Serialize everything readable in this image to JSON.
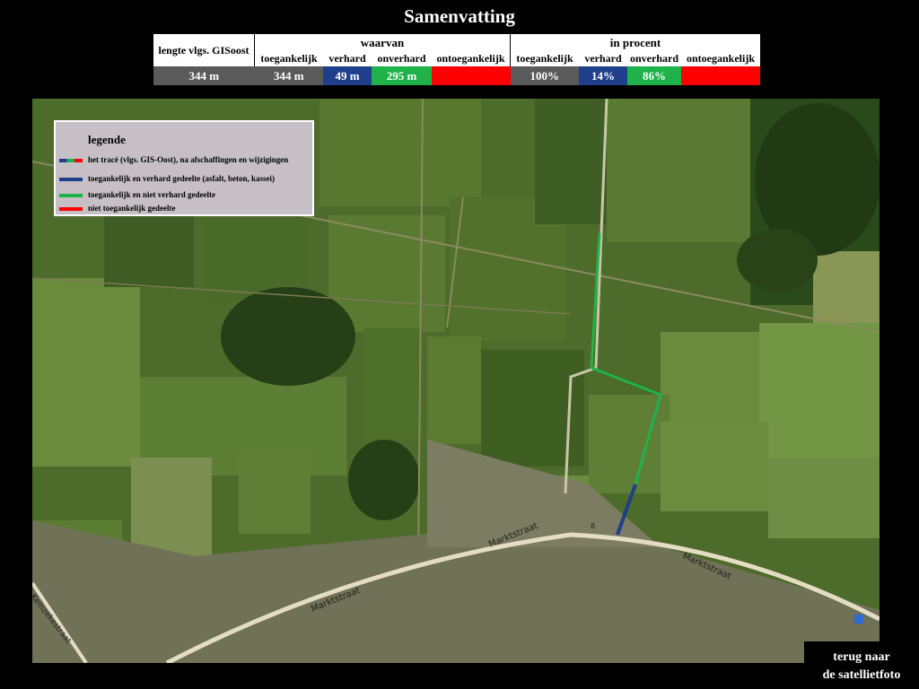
{
  "title": "Samenvatting",
  "summary": {
    "length_header": "lengte vlgs. GISoost",
    "group_waarvan": "waarvan",
    "group_procent": "in procent",
    "col_toegankelijk": "toegankelijk",
    "col_verhard": "verhard",
    "col_onverhard": "onverhard",
    "col_ontoegankelijk": "ontoegankelijk",
    "length_value": "344 m",
    "abs_toegankelijk": "344 m",
    "abs_verhard": "49 m",
    "abs_onverhard": "295 m",
    "abs_ontoegankelijk": "",
    "pct_toegankelijk": "100%",
    "pct_verhard": "14%",
    "pct_onverhard": "86%",
    "pct_ontoegankelijk": ""
  },
  "legend": {
    "title": "legende",
    "items": [
      "het tracé (vlgs. GIS-Oost), na afschaffingen en wijzigingen",
      "toegankelijk en verhard gedeelte (asfalt, beton, kassei)",
      "toegankelijk en niet verhard gedeelte",
      "niet toegankelijk gedeelte"
    ]
  },
  "map": {
    "street_labels": [
      "Marktstraat",
      "Marktstraat",
      "Marktstraat",
      "Kemzekestraat"
    ],
    "house_number": "8"
  },
  "back_link": {
    "line1": "terug naar",
    "line2": "de satellietfoto"
  },
  "colors": {
    "grey": "#5a5a5a",
    "blue": "#1f3f8c",
    "green": "#1fb24a",
    "red": "#ff0000",
    "legend_bg": "#c6c0c6"
  }
}
